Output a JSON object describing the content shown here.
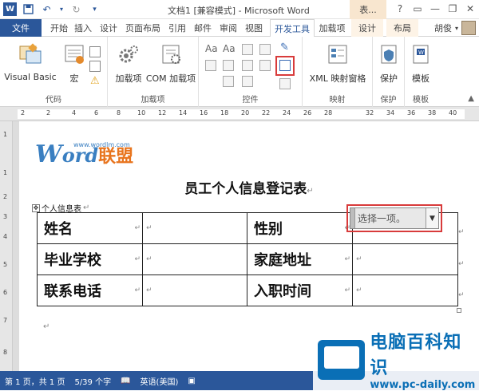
{
  "titlebar": {
    "title": "文档1 [兼容模式] - Microsoft Word",
    "context_tab": "表...",
    "help": "?",
    "minimize": "—",
    "restore": "❐",
    "close": "✕"
  },
  "tabs": {
    "file": "文件",
    "items": [
      "开始",
      "插入",
      "设计",
      "页面布局",
      "引用",
      "邮件",
      "审阅",
      "视图",
      "开发工具",
      "加载项",
      "设计",
      "布局"
    ],
    "user": "胡俊"
  },
  "ribbon": {
    "groups": {
      "code": "代码",
      "addins": "加载项",
      "controls": "控件",
      "mapping": "映射",
      "protect_label": "保护",
      "template_label": "模板"
    },
    "buttons": {
      "visual_basic": "Visual Basic",
      "macro": "宏",
      "addins": "加载项",
      "com_addins": "COM 加载项",
      "xml_mapping": "XML 映射窗格",
      "protect": "保护",
      "template": "模板"
    }
  },
  "ruler": {
    "h_marks": [
      "2",
      "2",
      "4",
      "6",
      "8",
      "10",
      "12",
      "14",
      "16",
      "18",
      "20",
      "22",
      "24",
      "26",
      "28",
      "32",
      "34",
      "36",
      "38",
      "40"
    ],
    "v_marks": [
      "1",
      "1",
      "2",
      "3",
      "4",
      "5",
      "6",
      "7",
      "8"
    ]
  },
  "document": {
    "logo_w": "W",
    "logo_ord": "ord",
    "logo_lm": "联盟",
    "logo_url": "www.wordlm.com",
    "title": "员工个人信息登记表",
    "caption": "个人信息表",
    "table": [
      [
        "姓名",
        "",
        "性别",
        ""
      ],
      [
        "毕业学校",
        "",
        "家庭地址",
        ""
      ],
      [
        "联系电话",
        "",
        "入职时间",
        ""
      ]
    ],
    "content_control_text": "选择一项。"
  },
  "status": {
    "page": "第 1 页，共 1 页",
    "words": "5/39 个字",
    "language": "英语(美国)"
  },
  "watermark": {
    "cn": "电脑百科知识",
    "en": "www.pc-daily.com"
  },
  "colors": {
    "word_blue": "#2b579a",
    "highlight_red": "#d83b3b",
    "logo_blue": "#3a7fc1",
    "logo_orange": "#e8741d"
  }
}
